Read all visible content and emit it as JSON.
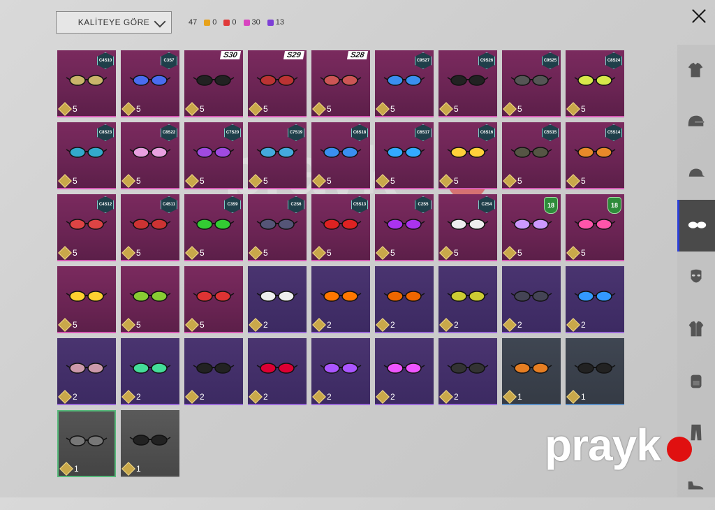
{
  "sort_label": "KALİTEYE GÖRE",
  "total_count": "47",
  "quality_counts": [
    {
      "color": "#e7a21b",
      "value": "0"
    },
    {
      "color": "#e03a3a",
      "value": "0"
    },
    {
      "color": "#d844c0",
      "value": "30"
    },
    {
      "color": "#7d3fd6",
      "value": "13"
    }
  ],
  "watermark": "prayk",
  "sidebar": [
    "shirt-icon",
    "helmet-icon",
    "cap-icon",
    "glasses-icon",
    "mask-icon",
    "jacket-icon",
    "backpack-icon",
    "pants-icon",
    "shoes-icon"
  ],
  "items": [
    {
      "tier": "epic",
      "badge": "C4S10",
      "cost": "5"
    },
    {
      "tier": "epic",
      "badge": "C3S7",
      "cost": "5"
    },
    {
      "tier": "epic",
      "sbadge": "S30",
      "cost": "5"
    },
    {
      "tier": "epic",
      "sbadge": "S29",
      "cost": "5"
    },
    {
      "tier": "epic",
      "sbadge": "S28",
      "cost": "5"
    },
    {
      "tier": "epic",
      "badge": "C9S27",
      "cost": "5"
    },
    {
      "tier": "epic",
      "badge": "C9S26",
      "cost": "5"
    },
    {
      "tier": "epic",
      "badge": "C9S25",
      "cost": "5"
    },
    {
      "tier": "epic",
      "badge": "C8S24",
      "cost": "5"
    },
    {
      "tier": "epic",
      "badge": "C8S23",
      "cost": "5"
    },
    {
      "tier": "epic",
      "badge": "C8S22",
      "cost": "5"
    },
    {
      "tier": "epic",
      "badge": "C7S20",
      "cost": "5"
    },
    {
      "tier": "epic",
      "badge": "C7S19",
      "cost": "5"
    },
    {
      "tier": "epic",
      "badge": "C6S18",
      "cost": "5"
    },
    {
      "tier": "epic",
      "badge": "C6S17",
      "cost": "5"
    },
    {
      "tier": "epic",
      "badge": "C6S16",
      "cost": "5"
    },
    {
      "tier": "epic",
      "badge": "C5S15",
      "cost": "5"
    },
    {
      "tier": "epic",
      "badge": "C5S14",
      "cost": "5"
    },
    {
      "tier": "epic",
      "badge": "C4S12",
      "cost": "5"
    },
    {
      "tier": "epic",
      "badge": "C4S11",
      "cost": "5"
    },
    {
      "tier": "epic",
      "badge": "C3S9",
      "cost": "5"
    },
    {
      "tier": "epic",
      "badge": "C2S6",
      "cost": "5"
    },
    {
      "tier": "epic",
      "badge": "C5S13",
      "cost": "5"
    },
    {
      "tier": "epic",
      "badge": "C2S5",
      "cost": "5"
    },
    {
      "tier": "epic",
      "badge": "C2S4",
      "cost": "5"
    },
    {
      "tier": "epic",
      "age": "18",
      "cost": "5"
    },
    {
      "tier": "epic",
      "age": "18",
      "cost": "5"
    },
    {
      "tier": "epic",
      "cost": "5"
    },
    {
      "tier": "epic",
      "cost": "5"
    },
    {
      "tier": "epic",
      "cost": "5"
    },
    {
      "tier": "purple",
      "cost": "2"
    },
    {
      "tier": "purple",
      "cost": "2"
    },
    {
      "tier": "purple",
      "cost": "2"
    },
    {
      "tier": "purple",
      "cost": "2"
    },
    {
      "tier": "purple",
      "cost": "2"
    },
    {
      "tier": "purple",
      "cost": "2"
    },
    {
      "tier": "purple",
      "cost": "2"
    },
    {
      "tier": "purple",
      "cost": "2"
    },
    {
      "tier": "purple",
      "cost": "2"
    },
    {
      "tier": "purple",
      "cost": "2"
    },
    {
      "tier": "purple",
      "cost": "2"
    },
    {
      "tier": "purple",
      "cost": "2"
    },
    {
      "tier": "purple",
      "cost": "2"
    },
    {
      "tier": "blue",
      "cost": "1"
    },
    {
      "tier": "blue",
      "cost": "1"
    },
    {
      "tier": "green",
      "cost": "1"
    },
    {
      "tier": "grey",
      "cost": "1"
    }
  ]
}
